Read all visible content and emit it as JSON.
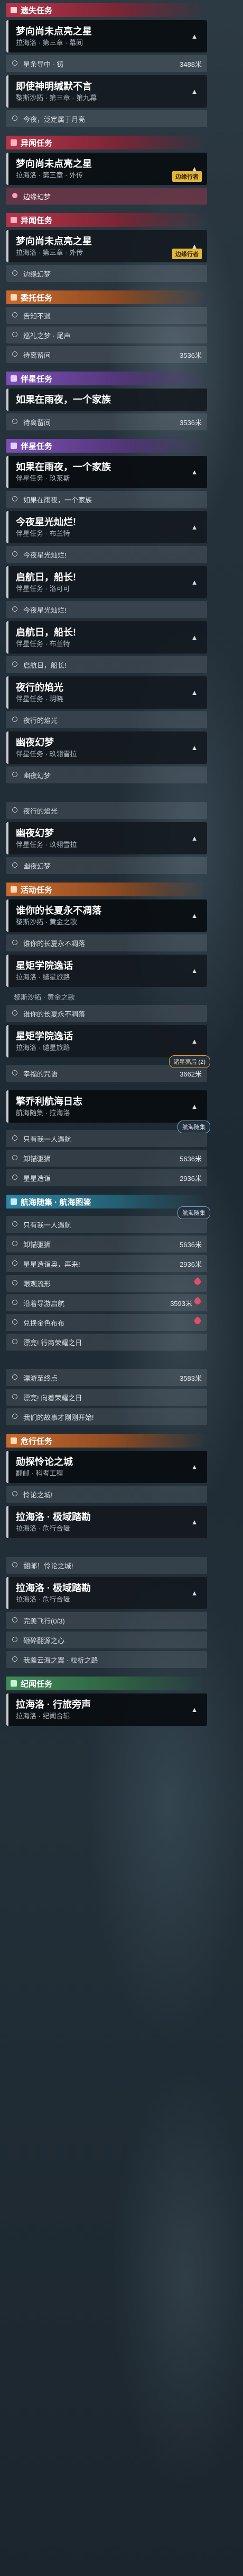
{
  "sections": {
    "top_mission": "遗失任务",
    "mystery": "异闻任务",
    "commission": "委托任务",
    "companion": "伴星任务",
    "event": "活动任务",
    "danger": "危行任务",
    "record": "纪闻任务"
  },
  "q1": {
    "title": "梦向尚未点亮之星",
    "sub": "拉海洛 · 第三章 · 幕间"
  },
  "q1_step": {
    "text": "星条导中 · 铸",
    "dist": "3488米"
  },
  "q2": {
    "title": "即使神明缄默不言",
    "sub": "黎斯沙拓 · 第三章 · 第九幕"
  },
  "q2_step": "今夜，泛定属于月亮",
  "q3": {
    "title": "梦向尚未点亮之星",
    "sub": "拉海洛 · 第三章 · 外传",
    "badge": "边缘行者"
  },
  "q3_step": "边缘幻梦",
  "q4": {
    "title": "梦向尚未点亮之星",
    "sub": "拉海洛 · 第三章 · 外传",
    "badge": "边缘行者"
  },
  "q4_step": "边缘幻梦",
  "c_steps": [
    {
      "text": "告知不遇"
    },
    {
      "text": "巡礼之梦 · 尾声"
    },
    {
      "text": "待离留间",
      "dist": "3536米"
    }
  ],
  "c_quest": {
    "title": "如果在雨夜，一个家族"
  },
  "c_step_after": {
    "text": "待离留间",
    "dist": "3536米"
  },
  "p1": {
    "title": "如果在雨夜，一个家族",
    "sub": "伴星任务 · 玖莱斯"
  },
  "p1_step": "如果在雨夜，一个家族",
  "p2": {
    "title": "今夜星光灿烂!",
    "sub": "伴星任务 · 布兰特"
  },
  "p2_step": "今夜星光灿烂!",
  "p3": {
    "title": "启航日，船长!",
    "sub": "伴星任务 · 洛可可"
  },
  "p3_step": "今夜星光灿烂!",
  "p4": {
    "title": "启航日，船长!",
    "sub": "伴星任务 · 布兰特"
  },
  "p4_step": "启航日，船长!",
  "p5": {
    "title": "夜行的焰光",
    "sub": "伴星任务 · 玥晓"
  },
  "p5_step": "夜行的焰光",
  "p6": {
    "title": "幽夜幻梦",
    "sub": "伴星任务 · 玖翎雪拉"
  },
  "p6_step": "幽夜幻梦",
  "p7_step": "夜行的焰光",
  "p8": {
    "title": "幽夜幻梦",
    "sub": "伴星任务 · 玖翎雪拉"
  },
  "p8_step": "幽夜幻梦",
  "e1": {
    "title": "谁你的长夏永不凋落",
    "sub": "黎斯沙拓 · 黄金之歌"
  },
  "e1_step": "谁你的长夏永不凋落",
  "e2": {
    "title": "星矩学院逸话",
    "sub": "拉海洛 · 缱星旅路"
  },
  "e2_tail": "黎斯沙拓 · 黄金之歌",
  "e3_step": "谁你的长夏永不凋落",
  "e4": {
    "title": "星矩学院逸话",
    "sub": "拉海洛 · 缱星旅路"
  },
  "e4_step": {
    "text": "幸福的咒语",
    "dist": "3662米"
  },
  "e4_pop": "诸星亮后 (2)",
  "d_log": {
    "title": "擎乔利航海日志",
    "sub": "航海随集 · 拉海洛"
  },
  "d_log_pop": "航海随集",
  "d_steps": [
    {
      "text": "只有我一人遇航"
    },
    {
      "text": "卸锚驱狮",
      "dist": "5636米"
    },
    {
      "text": "星星造诣",
      "dist": "2936米"
    }
  ],
  "d_section2": "航海随集 · 航海图鉴",
  "d2_pop": "航海随集",
  "d2_steps": [
    {
      "text": "只有我一人遇航"
    },
    {
      "text": "卸锚驱狮",
      "dist": "5636米"
    },
    {
      "text": "星星造诣奥，再来!",
      "dist": "2936米"
    },
    {
      "text": "眼观流形"
    },
    {
      "text": "沿着导游启航",
      "dist": "3593米"
    },
    {
      "text": "兑换金色布布"
    },
    {
      "text": "漂亮! 行商荣耀之日"
    }
  ],
  "d3_steps": [
    {
      "text": "漂游至终点",
      "dist": "3583米"
    },
    {
      "text": "漂亮! 向着荣耀之日"
    },
    {
      "text": "我们的故事才刚刚开始!"
    }
  ],
  "g1": {
    "title": "勋探怜论之城",
    "sub": "翻邮 · 科考工程"
  },
  "g1_step": "怜论之城!",
  "g2": {
    "title": "拉海洛 · 极域踏勘",
    "sub": "拉海洛 · 危行合辑"
  },
  "g3_step": "翻邮！怜论之城!",
  "g4": {
    "title": "拉海洛 · 极域踏勘",
    "sub": "拉海洛 · 危行合辑"
  },
  "g4_steps": [
    {
      "text": "完美飞行(0/3)"
    },
    {
      "text": "砸碎翻源之心"
    },
    {
      "text": "我差云海之翼 · 粒析之路"
    }
  ],
  "r1": {
    "title": "拉海洛 · 行旅旁声",
    "sub": "拉海洛 · 纪闻合辑"
  },
  "colors": {
    "accent_red": "#b5334a",
    "accent_purple": "#7b4fb3",
    "accent_orange": "#c9692c",
    "accent_teal": "#2f86a3",
    "badge_gold": "#e2b53c",
    "marker_pink": "#e24d6b"
  }
}
